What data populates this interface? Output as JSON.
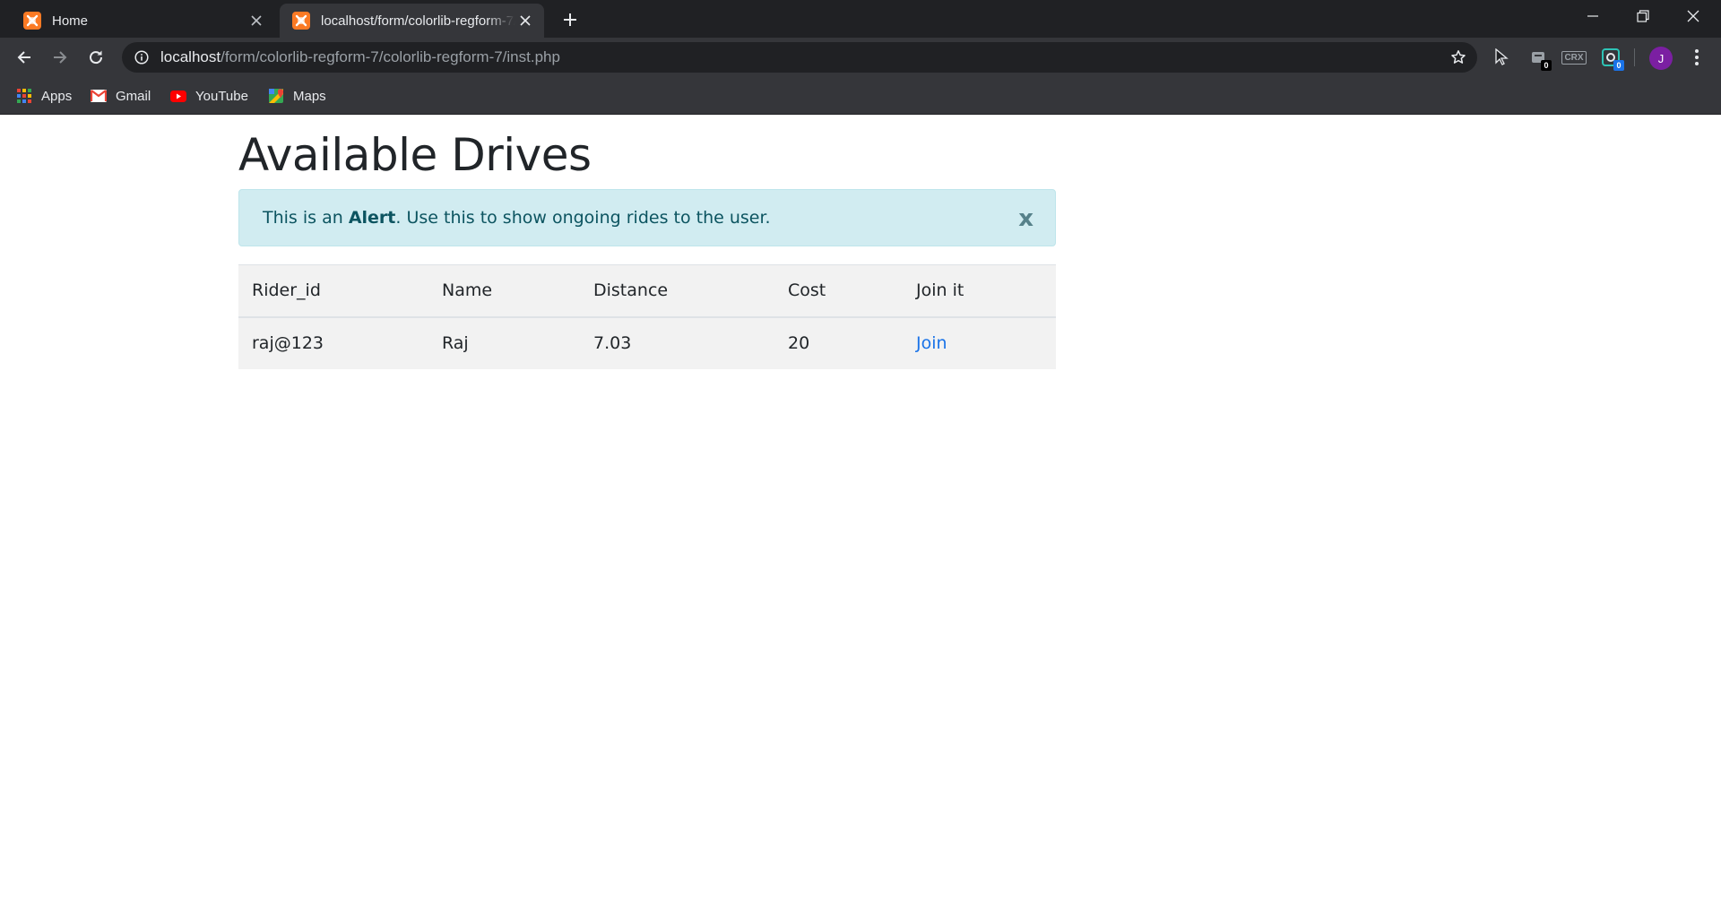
{
  "browser": {
    "tabs": [
      {
        "title": "Home",
        "active": false
      },
      {
        "title": "localhost/form/colorlib-regform-7/colorlib-regform-7/inst.php",
        "active": true
      }
    ],
    "address": {
      "host": "localhost",
      "path": "/form/colorlib-regform-7/colorlib-regform-7/inst.php"
    },
    "extensions": [
      {
        "name": "cursor-extension-icon"
      },
      {
        "name": "extension-badge-icon",
        "badge": "0"
      },
      {
        "name": "crx-extension-icon",
        "label": "CRX"
      },
      {
        "name": "screen-extension-icon",
        "badge": "0"
      }
    ],
    "profile_initial": "J",
    "bookmarks": [
      {
        "label": "Apps",
        "icon": "apps-grid-icon"
      },
      {
        "label": "Gmail",
        "icon": "gmail-icon"
      },
      {
        "label": "YouTube",
        "icon": "youtube-icon"
      },
      {
        "label": "Maps",
        "icon": "maps-icon"
      }
    ]
  },
  "page": {
    "title": "Available Drives",
    "alert": {
      "prefix": "This is an ",
      "strong": "Alert",
      "suffix": ". Use this to show ongoing rides to the user.",
      "close_label": "x"
    },
    "table": {
      "headers": [
        "Rider_id",
        "Name",
        "Distance",
        "Cost",
        "Join it"
      ],
      "rows": [
        {
          "rider_id": "raj@123",
          "name": "Raj",
          "distance": "7.03",
          "cost": "20",
          "join_label": "Join"
        }
      ]
    }
  },
  "colors": {
    "alert_bg": "#d1ecf1",
    "alert_text": "#0c5460",
    "table_bg": "#f2f2f2",
    "link": "#1a73e8",
    "chrome_dark": "#202124",
    "chrome_toolbar": "#35363a"
  }
}
